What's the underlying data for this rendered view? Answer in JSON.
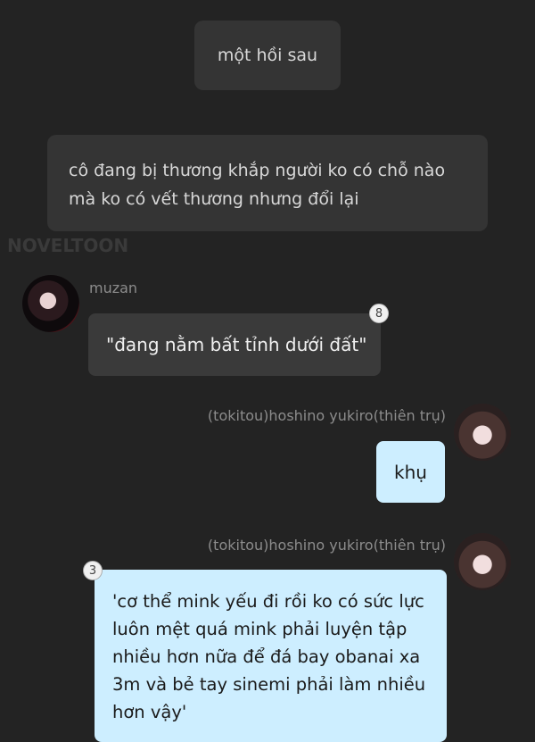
{
  "narrations": [
    "một hồi sau",
    "cô đang bị thương khắp người ko có chỗ nào mà ko có vết thương nhưng đổi lại"
  ],
  "watermark": "NOVELTOON",
  "messages": [
    {
      "sender": "muzan",
      "text": "\"đang nằm bất tỉnh dưới đất\"",
      "comment_count": "8"
    },
    {
      "sender": "(tokitou)hoshino yukiro(thiên trụ)",
      "text": "khụ"
    },
    {
      "sender": "(tokitou)hoshino yukiro(thiên trụ)",
      "text": "'cơ thể mink yếu đi rồi ko có sức lực luôn mệt quá mink phải luyện tập nhiều hơn nữa để đá bay obanai xa 3m và bẻ tay sinemi phải làm nhiều hơn vậy'",
      "comment_count": "3"
    }
  ],
  "colors": {
    "background": "#232323",
    "narration_bubble": "#343434",
    "left_bubble": "#3a3a3a",
    "right_bubble": "#cdeeff"
  }
}
